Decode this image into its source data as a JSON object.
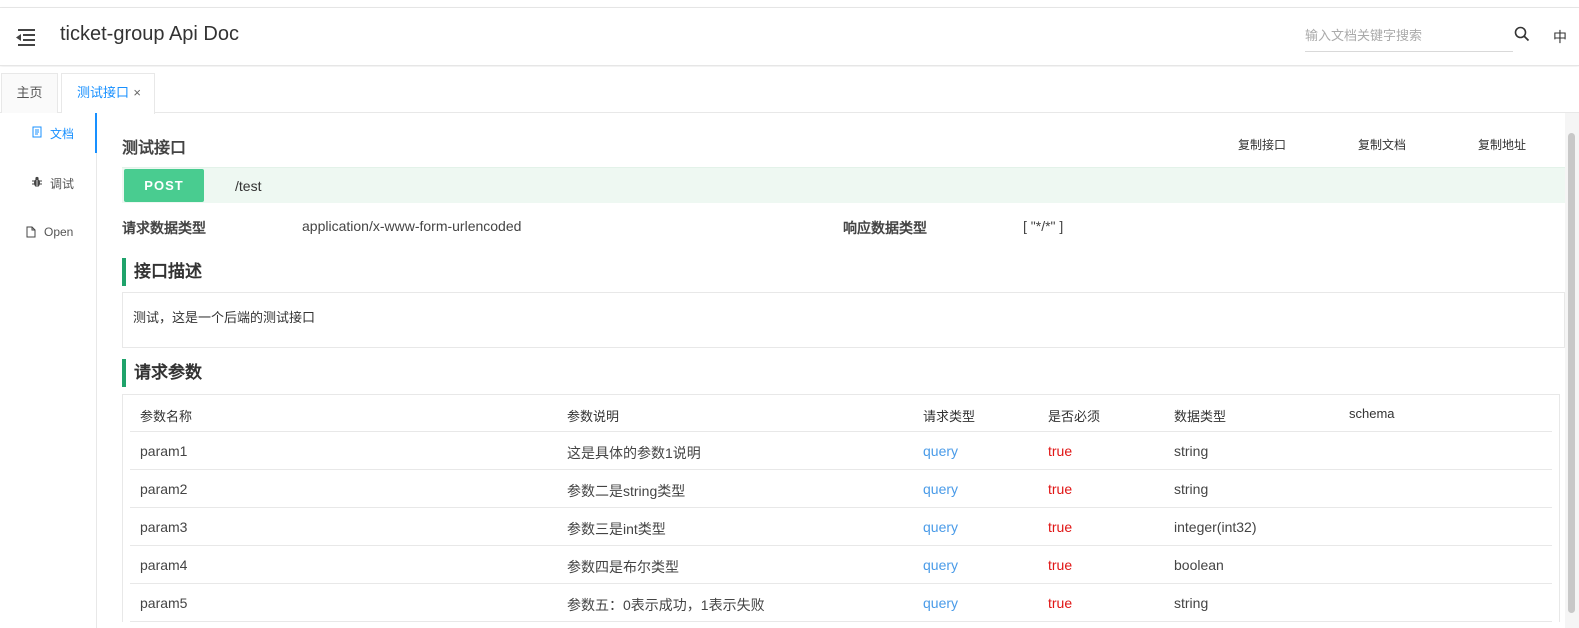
{
  "header": {
    "title": "ticket-group Api Doc",
    "search_placeholder": "输入文档关键字搜索",
    "lang": "中"
  },
  "tabs": [
    {
      "label": "主页"
    },
    {
      "label": "测试接口",
      "close": "×"
    }
  ],
  "sidebar": {
    "items": [
      {
        "label": "文档",
        "icon": "document-icon",
        "active": true
      },
      {
        "label": "调试",
        "icon": "bug-icon"
      },
      {
        "label": "Open",
        "icon": "file-icon"
      }
    ]
  },
  "api": {
    "title": "测试接口",
    "actions": [
      "复制接口",
      "复制文档",
      "复制地址"
    ],
    "method": "POST",
    "path": "/test",
    "request_type_label": "请求数据类型",
    "request_type": "application/x-www-form-urlencoded",
    "response_type_label": "响应数据类型",
    "response_type": "[ \"*/*\" ]",
    "desc_title": "接口描述",
    "description": "测试，这是一个后端的测试接口",
    "params_title": "请求参数"
  },
  "params": {
    "columns": [
      "参数名称",
      "参数说明",
      "请求类型",
      "是否必须",
      "数据类型",
      "schema"
    ],
    "rows": [
      {
        "name": "param1",
        "desc": "这是具体的参数1说明",
        "in": "query",
        "required": "true",
        "type": "string",
        "schema": ""
      },
      {
        "name": "param2",
        "desc": "参数二是string类型",
        "in": "query",
        "required": "true",
        "type": "string",
        "schema": ""
      },
      {
        "name": "param3",
        "desc": "参数三是int类型",
        "in": "query",
        "required": "true",
        "type": "integer(int32)",
        "schema": ""
      },
      {
        "name": "param4",
        "desc": "参数四是布尔类型",
        "in": "query",
        "required": "true",
        "type": "boolean",
        "schema": ""
      },
      {
        "name": "param5",
        "desc": "参数五：0表示成功，1表示失败",
        "in": "query",
        "required": "true",
        "type": "string",
        "schema": ""
      }
    ]
  },
  "colors": {
    "accent": "#1890ff",
    "post": "#49cc90",
    "section_bar": "#1fa36b",
    "query": "#4a9be8",
    "required": "#e01414"
  }
}
